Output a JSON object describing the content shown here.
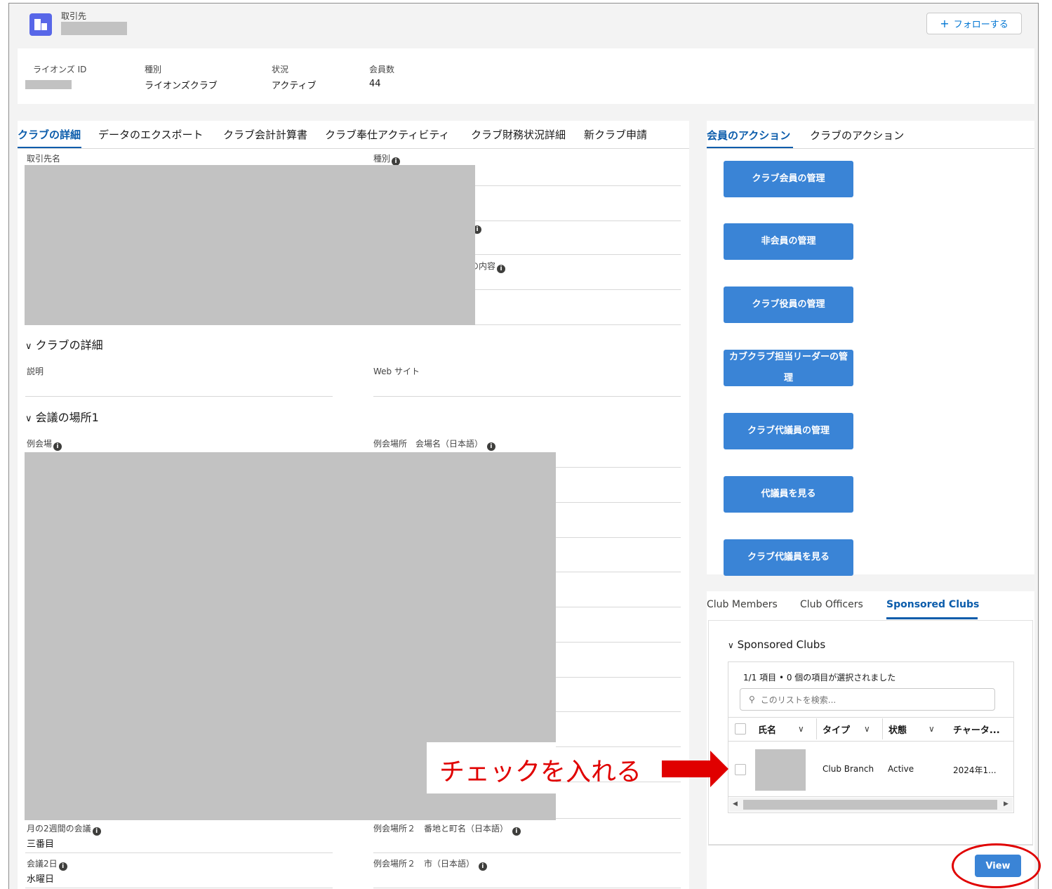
{
  "header": {
    "object_label": "取引先",
    "follow_label": "フォローする",
    "follow_icon": "plus-icon"
  },
  "highlights": [
    {
      "label": "ライオンズ ID",
      "value": ""
    },
    {
      "label": "種別",
      "value": "ライオンズクラブ"
    },
    {
      "label": "状況",
      "value": "アクティブ"
    },
    {
      "label": "会員数",
      "value": "44"
    }
  ],
  "left_tabs": [
    "クラブの詳細",
    "データのエクスポート",
    "クラブ会計計算書",
    "クラブ奉仕アクティビティ",
    "クラブ財務状況詳細",
    "新クラブ申請"
  ],
  "detail_fields": {
    "account_name": "取引先名",
    "type": "種別",
    "partial_label": "の内容"
  },
  "club_details": {
    "title": "クラブの詳細",
    "description": "説明",
    "website": "Web サイト"
  },
  "meeting": {
    "title": "会議の場所1",
    "venue": "例会場",
    "venue_name": "例会場所　会場名（日本語）",
    "biweekly_label": "月の2週間の会議",
    "biweekly_value": "三番目",
    "address2": "例会場所２　番地と町名（日本語）",
    "day2_label": "会議2日",
    "day2_value": "水曜日",
    "city2": "例会場所２　市（日本語）"
  },
  "right_tabs": [
    "会員のアクション",
    "クラブのアクション"
  ],
  "actions": [
    "クラブ会員の管理",
    "非会員の管理",
    "クラブ役員の管理",
    "カブクラブ担当リーダーの管理",
    "クラブ代議員の管理",
    "代議員を見る",
    "クラブ代議員を見る"
  ],
  "related_tabs": [
    "Club Members",
    "Club Officers",
    "Sponsored Clubs"
  ],
  "sponsored": {
    "title": "Sponsored Clubs",
    "count_text": "1/1 項目 • 0 個の項目が選択されました",
    "search_placeholder": "このリストを検索...",
    "columns": [
      "氏名",
      "タイプ",
      "状態",
      "チャータ..."
    ],
    "row": {
      "type": "Club Branch",
      "status": "Active",
      "charter": "2024年1..."
    }
  },
  "view_label": "View",
  "annotation": "チェックを入れる",
  "colors": {
    "brand": "#0b5cab",
    "button": "#3a84d6",
    "annotation": "#e00000"
  }
}
